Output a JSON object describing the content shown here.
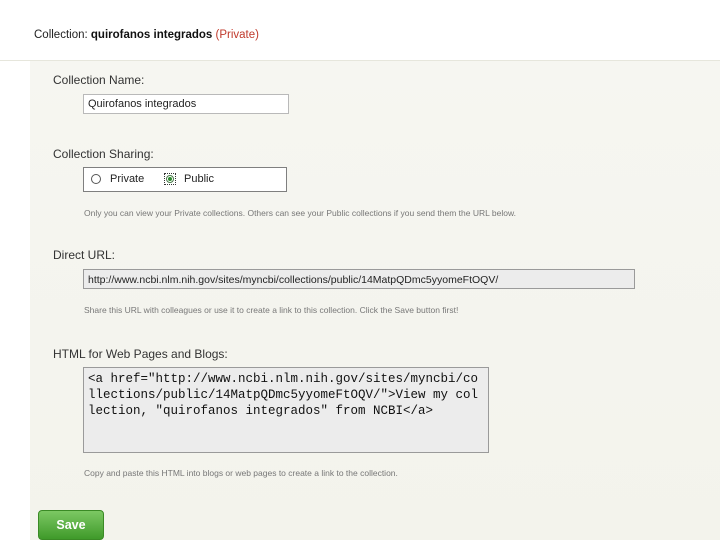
{
  "header": {
    "prefix": "Collection:",
    "collection_name": "quirofanos integrados",
    "privacy": "(Private)"
  },
  "form": {
    "name_label": "Collection Name:",
    "name_value": "Quirofanos integrados",
    "sharing_label": "Collection Sharing:",
    "sharing_options": [
      {
        "label": "Private",
        "selected": false
      },
      {
        "label": "Public",
        "selected": true
      }
    ],
    "sharing_help": "Only you can view your Private collections. Others can see your Public collections if you send them the URL below.",
    "url_label": "Direct URL:",
    "url_value": "http://www.ncbi.nlm.nih.gov/sites/myncbi/collections/public/14MatpQDmc5yyomeFtOQV/",
    "url_help": "Share this URL with colleagues or use it to create a link to this collection. Click the Save button first!",
    "html_label": "HTML for Web Pages and Blogs:",
    "html_value": "<a href=\"http://www.ncbi.nlm.nih.gov/sites/myncbi/collections/public/14MatpQDmc5yyomeFtOQV/\">View my collection, \"quirofanos integrados\" from NCBI</a>",
    "html_help": "Copy and paste this HTML into blogs or web pages to create a link to the collection.",
    "save_label": "Save"
  },
  "colors": {
    "save_button": "#4fae38",
    "private_text": "#c0392b",
    "panel_background": "#f5f5ef"
  }
}
